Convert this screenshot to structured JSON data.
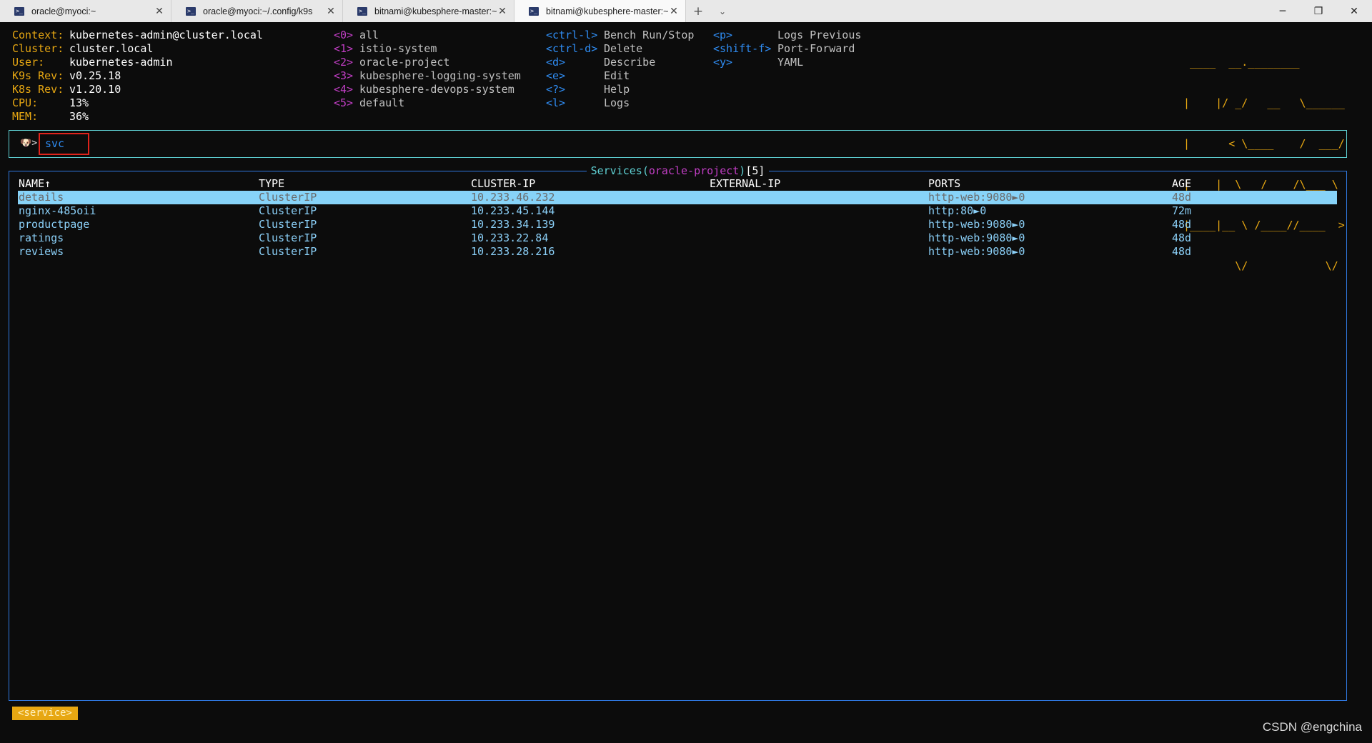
{
  "window": {
    "tabs": [
      {
        "title": "oracle@myoci:~"
      },
      {
        "title": "oracle@myoci:~/.config/k9s"
      },
      {
        "title": "bitnami@kubesphere-master:~"
      },
      {
        "title": "bitnami@kubesphere-master:~"
      }
    ],
    "close_glyph": "✕",
    "new_tab_glyph": "+",
    "tab_menu_glyph": "⌄",
    "minimize_glyph": "─",
    "restore_glyph": "❐",
    "close_window_glyph": "✕"
  },
  "info": [
    {
      "key": "Context:",
      "value": "kubernetes-admin@cluster.local"
    },
    {
      "key": "Cluster:",
      "value": "cluster.local"
    },
    {
      "key": "User:",
      "value": "kubernetes-admin"
    },
    {
      "key": "K9s Rev:",
      "value": "v0.25.18"
    },
    {
      "key": "K8s Rev:",
      "value": "v1.20.10"
    },
    {
      "key": "CPU:",
      "value": "13%"
    },
    {
      "key": "MEM:",
      "value": "36%"
    }
  ],
  "namespaces": [
    {
      "hotkey": "<0>",
      "label": "all"
    },
    {
      "hotkey": "<1>",
      "label": "istio-system"
    },
    {
      "hotkey": "<2>",
      "label": "oracle-project"
    },
    {
      "hotkey": "<3>",
      "label": "kubesphere-logging-system"
    },
    {
      "hotkey": "<4>",
      "label": "kubesphere-devops-system"
    },
    {
      "hotkey": "<5>",
      "label": "default"
    }
  ],
  "shortcuts_col1": [
    {
      "hotkey": "<ctrl-l>",
      "label": "Bench Run/Stop"
    },
    {
      "hotkey": "<ctrl-d>",
      "label": "Delete"
    },
    {
      "hotkey": "<d>",
      "label": "Describe"
    },
    {
      "hotkey": "<e>",
      "label": "Edit"
    },
    {
      "hotkey": "<?>",
      "label": "Help"
    },
    {
      "hotkey": "<l>",
      "label": "Logs"
    }
  ],
  "shortcuts_col2": [
    {
      "hotkey": "<p>",
      "label": "Logs Previous"
    },
    {
      "hotkey": "<shift-f>",
      "label": "Port-Forward"
    },
    {
      "hotkey": "<y>",
      "label": "YAML"
    }
  ],
  "logo": [
    " ____  __.________       ",
    "|    |/ _/   __   \\______",
    "|      < \\____    /  ___/",
    "|    |  \\   /    /\\___ \\ ",
    "|____|__ \\ /____//____  >",
    "        \\/            \\/ "
  ],
  "prompt": {
    "icon": "🐶",
    "caret": ">",
    "command": "svc"
  },
  "panel": {
    "resource": "Services",
    "open_paren": "(",
    "namespace": "oracle-project",
    "close_paren": ")",
    "count": "[5]"
  },
  "table": {
    "headers": [
      "NAME↑",
      "TYPE",
      "CLUSTER-IP",
      "EXTERNAL-IP",
      "PORTS",
      "AGE"
    ],
    "rows": [
      [
        "details",
        "ClusterIP",
        "10.233.46.232",
        "",
        "http-web:9080►0",
        "48d"
      ],
      [
        "nginx-485oii",
        "ClusterIP",
        "10.233.45.144",
        "",
        "http:80►0",
        "72m"
      ],
      [
        "productpage",
        "ClusterIP",
        "10.233.34.139",
        "",
        "http-web:9080►0",
        "48d"
      ],
      [
        "ratings",
        "ClusterIP",
        "10.233.22.84",
        "",
        "http-web:9080►0",
        "48d"
      ],
      [
        "reviews",
        "ClusterIP",
        "10.233.28.216",
        "",
        "http-web:9080►0",
        "48d"
      ]
    ]
  },
  "breadcrumb": "<service>",
  "watermark": "CSDN @engchina",
  "colors": {
    "background": "#0c0c0c",
    "info_key": "#e7a712",
    "hotkey_namespace": "#c13ec4",
    "hotkey_action": "#2f8cf2",
    "prompt_border": "#5fd1d4",
    "panel_border": "#2f78e0",
    "row_text": "#8bd0f8",
    "selected_row_bg": "#87d3f8",
    "highlight_box": "#e0231b"
  }
}
